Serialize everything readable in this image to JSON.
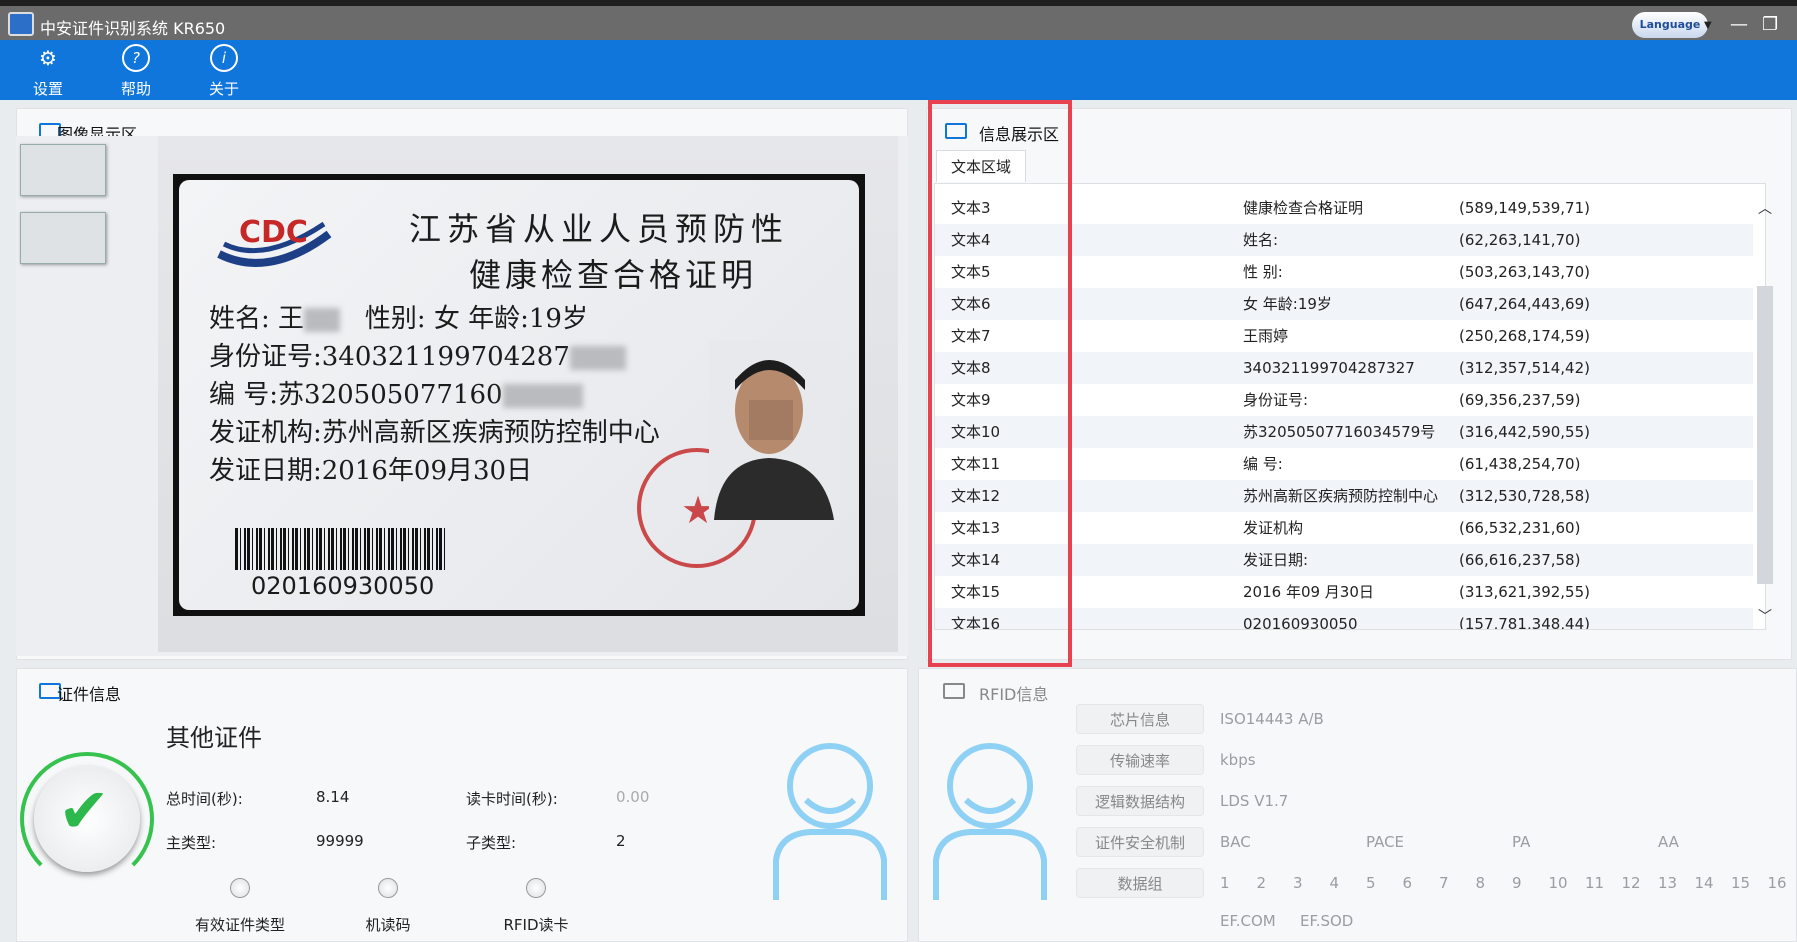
{
  "window": {
    "title": "中安证件识别系统 KR650",
    "language_label": "Language"
  },
  "toolbar": {
    "settings": "设置",
    "help": "帮助",
    "about": "关于"
  },
  "image_panel": {
    "title": "图像显示区",
    "card": {
      "title_line1": "江苏省从业人员预防性",
      "title_line2": "健康检查合格证明",
      "name_line": "姓名: 王",
      "gender_age": "性别: 女    年龄:19岁",
      "id_line": "身份证号:340321199704287",
      "no_line": "编     号:苏320505077160",
      "issuer_line": "发证机构:苏州高新区疾病预防控制中心",
      "date_line": "发证日期:2016年09月30日",
      "barcode_number": "020160930050"
    }
  },
  "info_panel": {
    "title": "信息展示区",
    "tab": "文本区域",
    "rows": [
      {
        "name": "文本3",
        "text": "健康检查合格证明",
        "coords": "(589,149,539,71)"
      },
      {
        "name": "文本4",
        "text": "姓名:",
        "coords": "(62,263,141,70)"
      },
      {
        "name": "文本5",
        "text": "性 别:",
        "coords": "(503,263,143,70)"
      },
      {
        "name": "文本6",
        "text": "女 年龄:19岁",
        "coords": "(647,264,443,69)"
      },
      {
        "name": "文本7",
        "text": "王雨婷",
        "coords": "(250,268,174,59)"
      },
      {
        "name": "文本8",
        "text": "340321199704287327",
        "coords": "(312,357,514,42)"
      },
      {
        "name": "文本9",
        "text": "身份证号:",
        "coords": "(69,356,237,59)"
      },
      {
        "name": "文本10",
        "text": "苏32050507716034579号",
        "coords": "(316,442,590,55)"
      },
      {
        "name": "文本11",
        "text": "编 号:",
        "coords": "(61,438,254,70)"
      },
      {
        "name": "文本12",
        "text": "苏州高新区疾病预防控制中心",
        "coords": "(312,530,728,58)"
      },
      {
        "name": "文本13",
        "text": "发证机构",
        "coords": "(66,532,231,60)"
      },
      {
        "name": "文本14",
        "text": "发证日期:",
        "coords": "(66,616,237,58)"
      },
      {
        "name": "文本15",
        "text": "2016 年09 月30日",
        "coords": "(313,621,392,55)"
      },
      {
        "name": "文本16",
        "text": "020160930050",
        "coords": "(157,781,348,44)"
      }
    ]
  },
  "cert_panel": {
    "title": "证件信息",
    "doc_type": "其他证件",
    "total_time_label": "总时间(秒):",
    "total_time": "8.14",
    "read_time_label": "读卡时间(秒):",
    "read_time": "0.00",
    "main_type_label": "主类型:",
    "main_type": "99999",
    "sub_type_label": "子类型:",
    "sub_type": "2",
    "radio_valid": "有效证件类型",
    "radio_mrz": "机读码",
    "radio_rfid": "RFID读卡"
  },
  "rfid_panel": {
    "title": "RFID信息",
    "chip_label": "芯片信息",
    "chip_value": "ISO14443 A/B",
    "speed_label": "传输速率",
    "speed_value": "kbps",
    "lds_label": "逻辑数据结构",
    "lds_value": "LDS V1.7",
    "security_label": "证件安全机制",
    "security_items": [
      "BAC",
      "PACE",
      "PA",
      "AA"
    ],
    "dg_label": "数据组",
    "dg_items": [
      "1",
      "2",
      "3",
      "4",
      "5",
      "6",
      "7",
      "8",
      "9",
      "10",
      "11",
      "12",
      "13",
      "14",
      "15",
      "16"
    ],
    "ef_items": [
      "EF.COM",
      "EF.SOD"
    ]
  },
  "colors": {
    "accent": "#1176dc",
    "highlight_box": "#e8414f",
    "success": "#2cb84a",
    "avatar": "#8fd0f5"
  }
}
